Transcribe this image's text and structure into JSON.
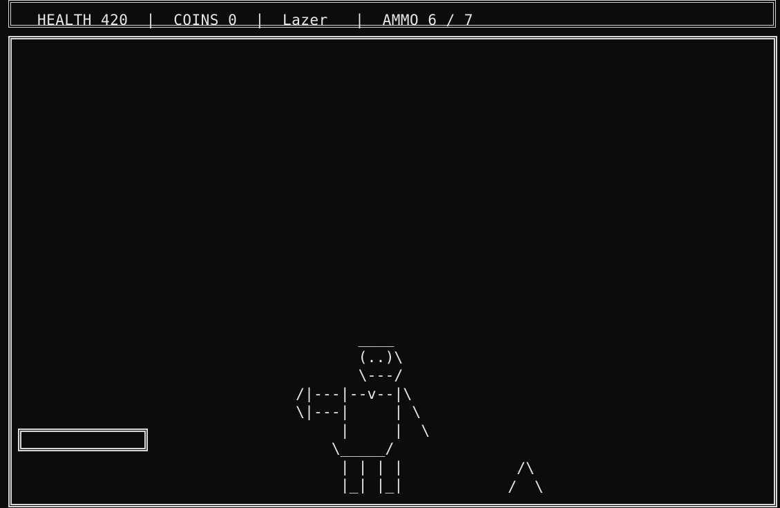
{
  "hud": {
    "health_label": "HEALTH",
    "health_value": "420",
    "coins_label": "COINS",
    "coins_value": "0",
    "weapon": "Lazer",
    "ammo_label": "AMMO",
    "ammo_current": "6",
    "ammo_max": "7",
    "separator": "|"
  },
  "player_sprite": "       ____\n       (..)\\\n       \\---/\n/|---|--v--|\\\n\\|---|     | \\\n     |     |  \\\n    \\_____/\n     | | | |\n     |_| |_|",
  "spike_sprite": "  /\\\n /  \\"
}
